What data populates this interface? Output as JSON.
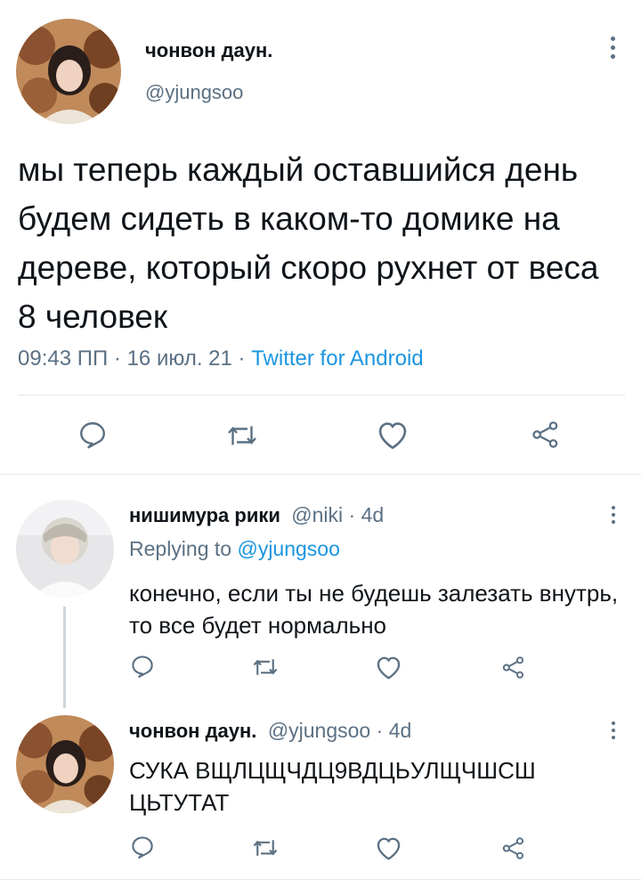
{
  "main_tweet": {
    "author_name": "чонвон даун.",
    "author_handle": "@yjungsoo",
    "text": "мы теперь каждый оставшийся день будем сидеть в каком-то домике на дереве, который скоро рухнет от веса 8 человек",
    "time": "09:43 ПП",
    "date": "16 июл. 21",
    "source": "Twitter for Android",
    "separator": "·"
  },
  "replies": [
    {
      "author_name": "нишимура рики",
      "author_handle": "@niki",
      "age": "4d",
      "replying_prefix": "Replying to",
      "replying_to": "@yjungsoo",
      "text": "конечно, если ты не будешь залезать внутрь, то все будет нормально"
    },
    {
      "author_name": "чонвон даун.",
      "author_handle": "@yjungsoo",
      "age": "4d",
      "text": "СУКА ВЩЛЦЩЧДЦ9ВДЦЬУЛЩЧШСШ ЦЬТУТАТ"
    }
  ],
  "icons": {
    "reply": "reply-icon",
    "retweet": "retweet-icon",
    "like": "like-icon",
    "share": "share-icon",
    "more": "more-icon"
  },
  "colors": {
    "text": "#0f1419",
    "secondary": "#5b7083",
    "link": "#1b95e0",
    "divider": "#e1e8ed"
  }
}
